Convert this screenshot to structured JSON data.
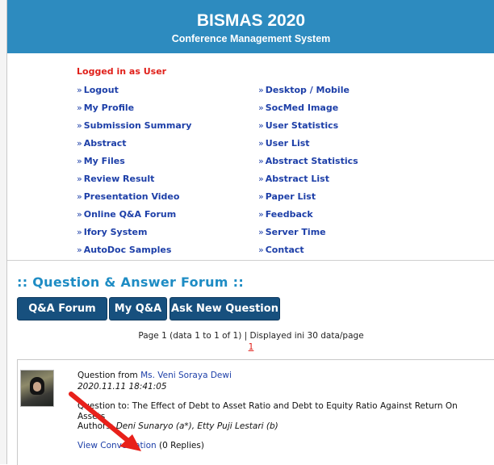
{
  "header": {
    "title": "BISMAS 2020",
    "subtitle": "Conference Management System"
  },
  "menu": {
    "logged_in": "Logged in as User",
    "left_items": [
      {
        "label": "Logout"
      },
      {
        "label": "My Profile"
      },
      {
        "label": "Submission Summary"
      },
      {
        "label": "Abstract"
      },
      {
        "label": "My Files"
      },
      {
        "label": "Review Result"
      },
      {
        "label": "Presentation Video"
      },
      {
        "label": "Online Q&A Forum"
      },
      {
        "label": "Ifory System"
      },
      {
        "label": "AutoDoc Samples"
      }
    ],
    "right_items": [
      {
        "label": "Desktop / Mobile"
      },
      {
        "label": "SocMed Image"
      },
      {
        "label": "User Statistics"
      },
      {
        "label": "User List"
      },
      {
        "label": "Abstract Statistics"
      },
      {
        "label": "Abstract List"
      },
      {
        "label": "Paper List"
      },
      {
        "label": "Feedback"
      },
      {
        "label": "Server Time"
      },
      {
        "label": "Contact"
      }
    ],
    "bullet": "»"
  },
  "forum": {
    "title": ":: Question & Answer Forum ::",
    "buttons": {
      "qa_forum": "Q&A Forum",
      "my_qa": "My Q&A",
      "ask_new": "Ask New Question"
    },
    "pagination_text": "Page 1 (data 1 to 1 of 1) | Displayed ini 30 data/page",
    "page_link": "1"
  },
  "question": {
    "from_prefix": "Question from ",
    "from_name": "Ms. Veni Soraya Dewi",
    "datetime": "2020.11.11 18:41:05",
    "to_prefix": "Question to: ",
    "to_title_line1": "The Effect of Debt to Asset Ratio and Debt to Equity Ratio Against Return On",
    "to_title_line2": "Assets",
    "authors_prefix": "Authors: ",
    "authors": "Deni Sunaryo (a*), Etty Puji Lestari (b)",
    "view_link": "View Conversation",
    "replies": " (0 Replies)"
  },
  "annotation": {
    "arrow_color": "#e8201a"
  }
}
